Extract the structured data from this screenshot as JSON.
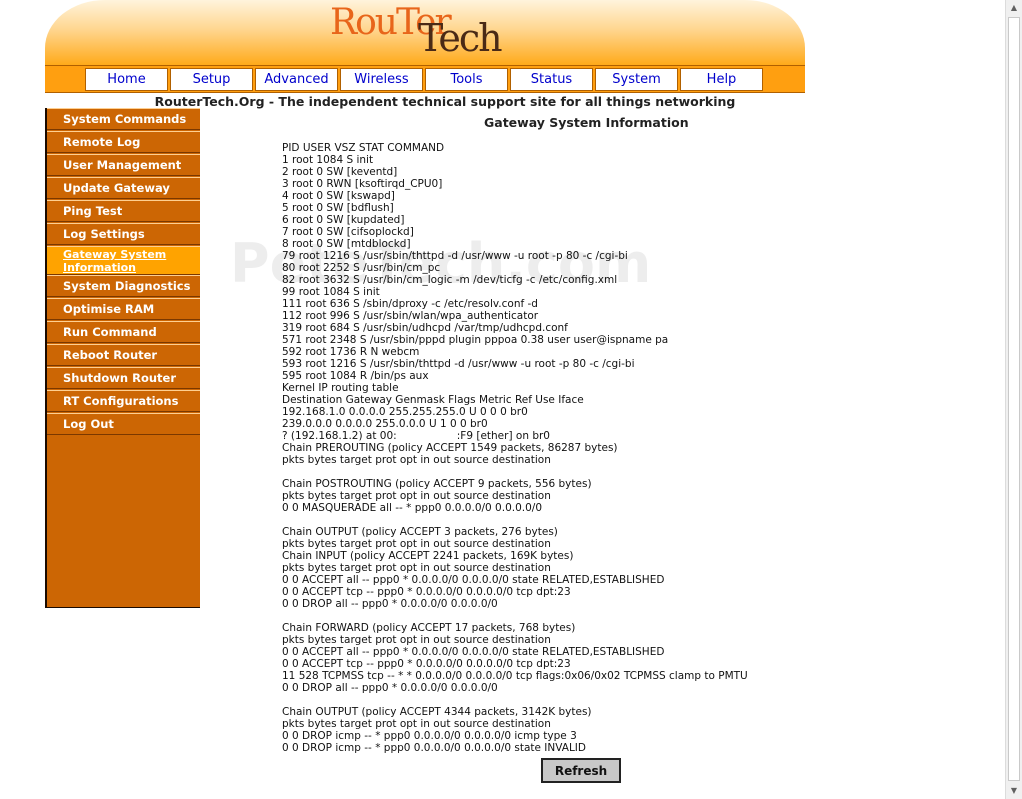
{
  "header": {
    "logo_part1": "RouTer",
    "logo_part2": "Tech",
    "tagline": "RouterTech.Org - The independent technical support site for all things networking"
  },
  "nav": {
    "items": [
      "Home",
      "Setup",
      "Advanced",
      "Wireless",
      "Tools",
      "Status",
      "System",
      "Help"
    ]
  },
  "sidebar": {
    "items": [
      "System Commands",
      "Remote Log",
      "User Management",
      "Update Gateway",
      "Ping Test",
      "Log Settings",
      "Gateway System Information",
      "System Diagnostics",
      "Optimise RAM",
      "Run Command",
      "Reboot Router",
      "Shutdown Router",
      "RT Configurations",
      "Log Out"
    ],
    "active_index": 6
  },
  "main": {
    "title": "Gateway System Information",
    "watermark": "PeteTech.com",
    "output_lines": [
      "PID USER VSZ STAT COMMAND",
      "1 root 1084 S init",
      "2 root 0 SW [keventd]",
      "3 root 0 RWN [ksoftirqd_CPU0]",
      "4 root 0 SW [kswapd]",
      "5 root 0 SW [bdflush]",
      "6 root 0 SW [kupdated]",
      "7 root 0 SW [cifsoplockd]",
      "8 root 0 SW [mtdblockd]",
      "79 root 1216 S /usr/sbin/thttpd -d /usr/www -u root -p 80 -c /cgi-bi",
      "80 root 2252 S /usr/bin/cm_pc",
      "82 root 3632 S /usr/bin/cm_logic -m /dev/ticfg -c /etc/config.xml",
      "99 root 1084 S init",
      "111 root 636 S /sbin/dproxy -c /etc/resolv.conf -d",
      "112 root 996 S /usr/sbin/wlan/wpa_authenticator",
      "319 root 684 S /usr/sbin/udhcpd /var/tmp/udhcpd.conf",
      "571 root 2348 S /usr/sbin/pppd plugin pppoa 0.38 user user@ispname pa",
      "592 root 1736 R N webcm",
      "593 root 1216 S /usr/sbin/thttpd -d /usr/www -u root -p 80 -c /cgi-bi",
      "595 root 1084 R /bin/ps aux",
      "Kernel IP routing table",
      "Destination Gateway Genmask Flags Metric Ref Use Iface",
      "192.168.1.0 0.0.0.0 255.255.255.0 U 0 0 0 br0",
      "239.0.0.0 0.0.0.0 255.0.0.0 U 1 0 0 br0",
      "? (192.168.1.2) at 00:                  :F9 [ether] on br0",
      "Chain PREROUTING (policy ACCEPT 1549 packets, 86287 bytes)",
      "pkts bytes target prot opt in out source destination",
      "",
      "Chain POSTROUTING (policy ACCEPT 9 packets, 556 bytes)",
      "pkts bytes target prot opt in out source destination",
      "0 0 MASQUERADE all -- * ppp0 0.0.0.0/0 0.0.0.0/0",
      "",
      "Chain OUTPUT (policy ACCEPT 3 packets, 276 bytes)",
      "pkts bytes target prot opt in out source destination",
      "Chain INPUT (policy ACCEPT 2241 packets, 169K bytes)",
      "pkts bytes target prot opt in out source destination",
      "0 0 ACCEPT all -- ppp0 * 0.0.0.0/0 0.0.0.0/0 state RELATED,ESTABLISHED",
      "0 0 ACCEPT tcp -- ppp0 * 0.0.0.0/0 0.0.0.0/0 tcp dpt:23",
      "0 0 DROP all -- ppp0 * 0.0.0.0/0 0.0.0.0/0",
      "",
      "Chain FORWARD (policy ACCEPT 17 packets, 768 bytes)",
      "pkts bytes target prot opt in out source destination",
      "0 0 ACCEPT all -- ppp0 * 0.0.0.0/0 0.0.0.0/0 state RELATED,ESTABLISHED",
      "0 0 ACCEPT tcp -- ppp0 * 0.0.0.0/0 0.0.0.0/0 tcp dpt:23",
      "11 528 TCPMSS tcp -- * * 0.0.0.0/0 0.0.0.0/0 tcp flags:0x06/0x02 TCPMSS clamp to PMTU",
      "0 0 DROP all -- ppp0 * 0.0.0.0/0 0.0.0.0/0",
      "",
      "Chain OUTPUT (policy ACCEPT 4344 packets, 3142K bytes)",
      "pkts bytes target prot opt in out source destination",
      "0 0 DROP icmp -- * ppp0 0.0.0.0/0 0.0.0.0/0 icmp type 3",
      "0 0 DROP icmp -- * ppp0 0.0.0.0/0 0.0.0.0/0 state INVALID"
    ],
    "refresh_label": "Refresh"
  },
  "colors": {
    "sidebar_bg": "#cc6604",
    "sidebar_active": "#ffa300",
    "nav_bg": "#ff9f10",
    "nav_link": "#0000cc"
  },
  "scrollbar": {
    "up_icon": "▲",
    "down_icon": "▼"
  }
}
